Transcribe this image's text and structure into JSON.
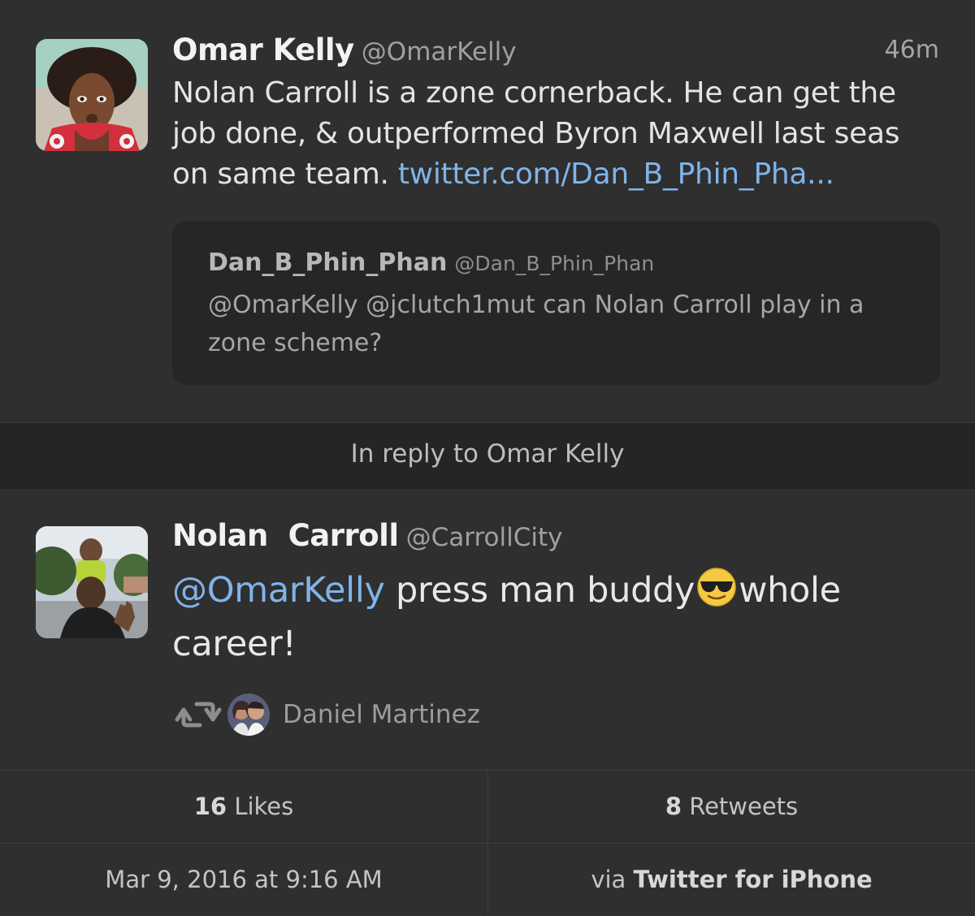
{
  "original_tweet": {
    "display_name": "Omar Kelly",
    "handle": "@OmarKelly",
    "time": "46m",
    "text": "Nolan Carroll is a zone cornerback. He can get the job done, & outperformed Byron Maxwell last seas on same team.",
    "link": "twitter.com/Dan_B_Phin_Pha...",
    "link_color": "#7fb4ea",
    "quoted": {
      "display_name": "Dan_B_Phin_Phan",
      "handle": "@Dan_B_Phin_Phan",
      "text": "@OmarKelly @jclutch1mut can Nolan Carroll play in a zone scheme?"
    }
  },
  "reply_banner": "In reply to Omar Kelly",
  "reply_tweet": {
    "display_name": "Nolan  Carroll",
    "handle": "@CarrollCity",
    "mention": "@OmarKelly",
    "text_before_emoji": "press man buddy",
    "emoji": "sunglasses-emoji",
    "text_after_emoji": "whole career!",
    "retweeted_by": "Daniel Martinez"
  },
  "stats": {
    "likes_count": "16",
    "likes_label": "Likes",
    "retweets_count": "8",
    "retweets_label": "Retweets",
    "date": "Mar 9, 2016 at 9:16 AM",
    "via_prefix": "via",
    "client": "Twitter for iPhone"
  },
  "icons": {
    "retweet": "retweet-icon"
  }
}
